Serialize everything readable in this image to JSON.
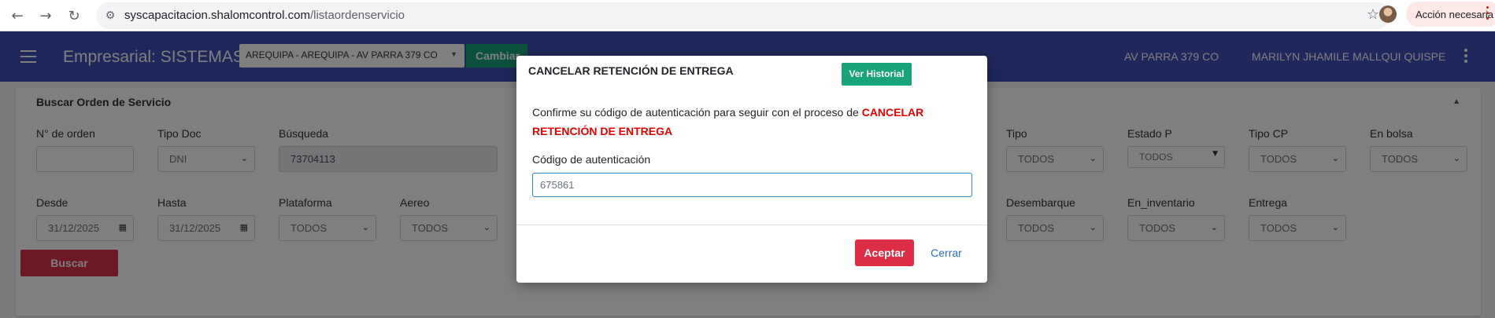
{
  "browser": {
    "url_host": "syscapacitacion.shalomcontrol.com",
    "url_path": "/listaordenservicio",
    "action_label": "Acción necesaria"
  },
  "appbar": {
    "brand": "Empresarial: SISTEMAS",
    "branch_selected": "AREQUIPA - AREQUIPA - AV PARRA 379 CO",
    "change_label": "Cambiar",
    "branch_short": "AV PARRA 379 CO",
    "user_name": "MARILYN JHAMILE MALLQUI QUISPE"
  },
  "search": {
    "title": "Buscar Orden de Servicio",
    "row1": [
      {
        "label": "N° de orden",
        "value": ""
      },
      {
        "label": "Tipo Doc",
        "value": "DNI"
      },
      {
        "label": "Búsqueda",
        "value": "73704113"
      },
      {
        "label": "Tipo",
        "value": "TODOS"
      },
      {
        "label": "Estado P",
        "value": "TODOS"
      },
      {
        "label": "Tipo CP",
        "value": "TODOS"
      },
      {
        "label": "En bolsa",
        "value": "TODOS"
      }
    ],
    "row2": [
      {
        "label": "Desde",
        "value": "31/12/2025"
      },
      {
        "label": "Hasta",
        "value": "31/12/2025"
      },
      {
        "label": "Plataforma",
        "value": "TODOS"
      },
      {
        "label": "Aereo",
        "value": "TODOS"
      },
      {
        "label": "Desembarque",
        "value": "TODOS"
      },
      {
        "label": "En_inventario",
        "value": "TODOS"
      },
      {
        "label": "Entrega",
        "value": "TODOS"
      }
    ],
    "search_button": "Buscar"
  },
  "modal": {
    "title": "CANCELAR RETENCIÓN DE ENTREGA",
    "history_button": "Ver Historial",
    "message": "Confirme su código de autenticación para seguir con el proceso de",
    "message_emphasis": "CANCELAR RETENCIÓN DE ENTREGA",
    "field_label": "Código de autenticación",
    "field_value": "675861",
    "accept_button": "Aceptar",
    "close_button": "Cerrar"
  },
  "colors": {
    "appbar": "#3f51b5",
    "accent_green": "#18a37a",
    "danger_red": "#dc2e44",
    "warning_text": "#e60000",
    "link_blue": "#2c6fbd"
  }
}
